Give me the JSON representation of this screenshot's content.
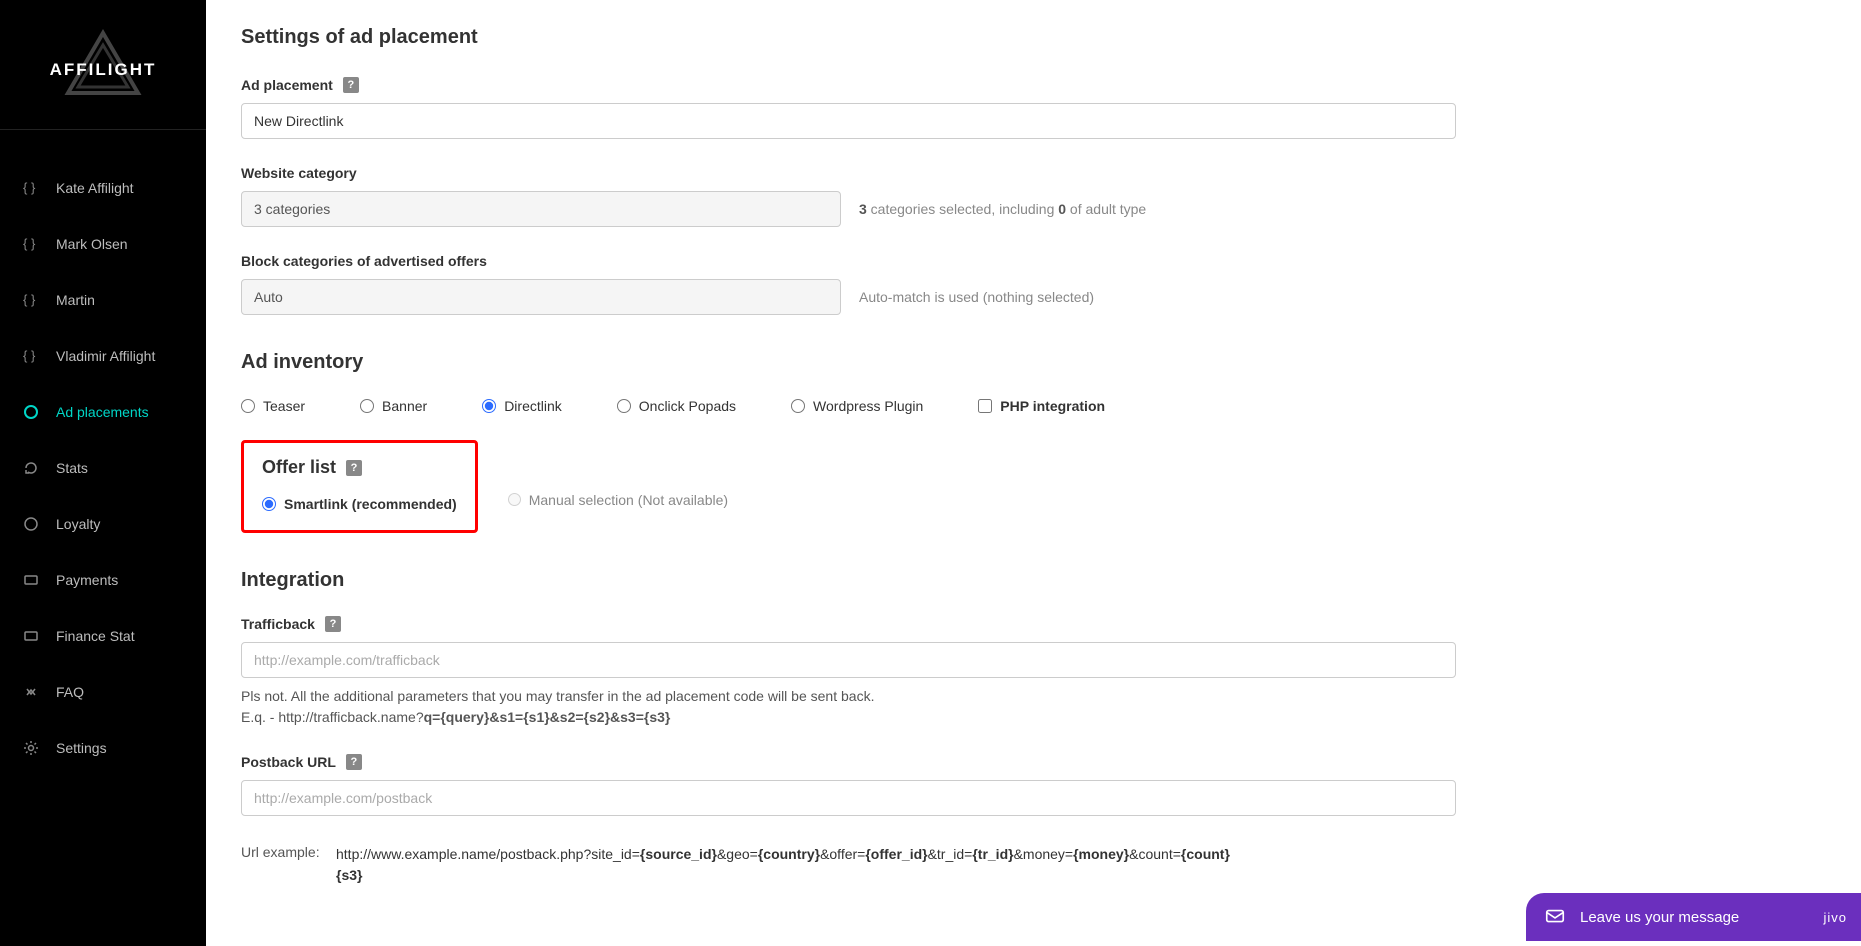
{
  "brand": "AFFILIGHT",
  "sidebar": {
    "items": [
      {
        "label": "Kate Affilight",
        "icon": "braces-icon",
        "active": false
      },
      {
        "label": "Mark Olsen",
        "icon": "braces-icon",
        "active": false
      },
      {
        "label": "Martin",
        "icon": "braces-icon",
        "active": false
      },
      {
        "label": "Vladimir Affilight",
        "icon": "braces-icon",
        "active": false
      },
      {
        "label": "Ad placements",
        "icon": "circle-ring-icon",
        "active": true
      },
      {
        "label": "Stats",
        "icon": "refresh-icon",
        "active": false
      },
      {
        "label": "Loyalty",
        "icon": "circle-outline-icon",
        "active": false
      },
      {
        "label": "Payments",
        "icon": "card-icon",
        "active": false
      },
      {
        "label": "Finance Stat",
        "icon": "card-icon",
        "active": false
      },
      {
        "label": "FAQ",
        "icon": "diamond-icon",
        "active": false
      },
      {
        "label": "Settings",
        "icon": "gear-icon",
        "active": false
      }
    ]
  },
  "sections": {
    "settings_title": "Settings of ad placement",
    "ad_placement_label": "Ad placement",
    "ad_placement_value": "New Directlink",
    "website_category_label": "Website category",
    "website_category_value": "3 categories",
    "website_category_hint_prefix": "3",
    "website_category_hint_mid": " categories selected, including ",
    "website_category_hint_num": "0",
    "website_category_hint_suffix": " of adult type",
    "block_categories_label": "Block categories of advertised offers",
    "block_categories_value": "Auto",
    "block_categories_hint": "Auto-match is used (nothing selected)",
    "ad_inventory_title": "Ad inventory",
    "inventory_options": {
      "teaser": "Teaser",
      "banner": "Banner",
      "directlink": "Directlink",
      "onclick": "Onclick Popads",
      "wordpress": "Wordpress Plugin",
      "php": "PHP integration"
    },
    "offer_list_title": "Offer list",
    "offer_smartlink": "Smartlink (recommended)",
    "offer_manual": "Manual selection",
    "offer_na": "(Not available)",
    "integration_title": "Integration",
    "trafficback_label": "Trafficback",
    "trafficback_placeholder": "http://example.com/trafficback",
    "trafficback_hint_line1": "Pls not. All the additional parameters that you may transfer in the ad placement code will be sent back.",
    "trafficback_hint_line2_prefix": "E.q. - http://trafficback.name?",
    "trafficback_hint_line2_bold": "q={query}&s1={s1}&s2={s2}&s3={s3}",
    "postback_label": "Postback URL",
    "postback_placeholder": "http://example.com/postback",
    "url_example_label": "Url example:",
    "url_example_prefix": "http://www.example.name/postback.php?site_id=",
    "url_example_p1": "{source_id}",
    "url_example_m1": "&geo=",
    "url_example_p2": "{country}",
    "url_example_m2": "&offer=",
    "url_example_p3": "{offer_id}",
    "url_example_m3": "&tr_id=",
    "url_example_p4": "{tr_id}",
    "url_example_m4": "&money=",
    "url_example_p5": "{money}",
    "url_example_m5": "&count=",
    "url_example_p6": "{count}",
    "url_example_tail": "{s3}"
  },
  "chat": {
    "text": "Leave us your message",
    "brand": "jivo"
  }
}
